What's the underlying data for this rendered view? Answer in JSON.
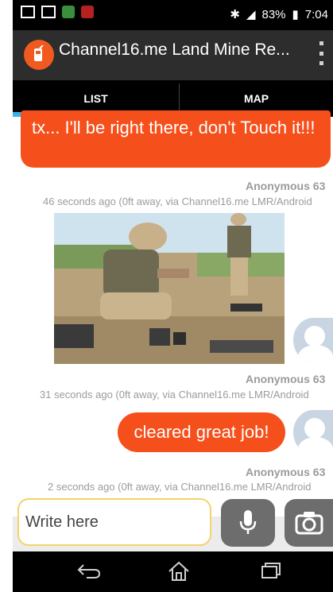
{
  "status_bar": {
    "battery": "83%",
    "time": "7:04"
  },
  "app_bar": {
    "title": "Channel16.me Land Mine Re..."
  },
  "tabs": [
    {
      "label": "LIST",
      "selected": true
    },
    {
      "label": "MAP",
      "selected": false
    }
  ],
  "colors": {
    "bubble": "#f5501c",
    "tab_indicator": "#33b5e5",
    "input_border": "#f3d36a"
  },
  "messages": [
    {
      "text": "tx...  I'll be right there, don't Touch it!!!",
      "sender": "Anonymous 63",
      "meta": "46 seconds ago  (0ft away, via Channel16.me LMR/Android"
    },
    {
      "image": "soldiers-demining-photo",
      "sender": "Anonymous 63",
      "meta": "31 seconds ago  (0ft away, via Channel16.me LMR/Android"
    },
    {
      "text": "cleared great job!",
      "sender": "Anonymous 63",
      "meta": "2 seconds ago  (0ft away, via Channel16.me LMR/Android"
    }
  ],
  "composer": {
    "placeholder": "Write here"
  },
  "nav_icons": [
    "back-icon",
    "home-icon",
    "recents-icon"
  ]
}
